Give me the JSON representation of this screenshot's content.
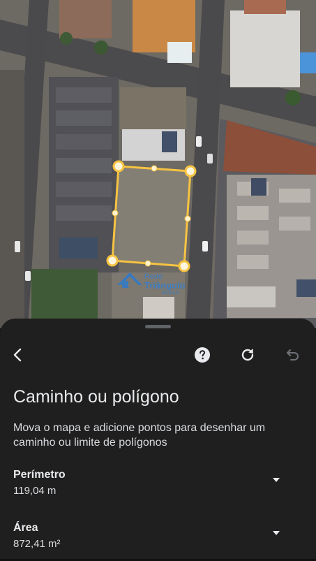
{
  "map": {
    "watermark": {
      "line1": "Rede",
      "line2": "Triângulo",
      "line3": "IMÓVEIS"
    }
  },
  "panel": {
    "title": "Caminho ou polígono",
    "description": "Mova o mapa e adicione pontos para desenhar um caminho ou limite de polígonos",
    "measurements": [
      {
        "label": "Perímetro",
        "value": "119,04 m"
      },
      {
        "label": "Área",
        "value": "872,41 m²"
      }
    ]
  },
  "icons": {
    "back": "back-arrow-icon",
    "help": "help-icon",
    "refresh": "refresh-icon",
    "undo": "undo-icon",
    "expand": "chevron-down-icon"
  },
  "colors": {
    "polygon": "#f6c342",
    "panel_bg": "#1f1f1f",
    "text_primary": "#e8eaed",
    "undo_disabled": "#6f7378"
  }
}
